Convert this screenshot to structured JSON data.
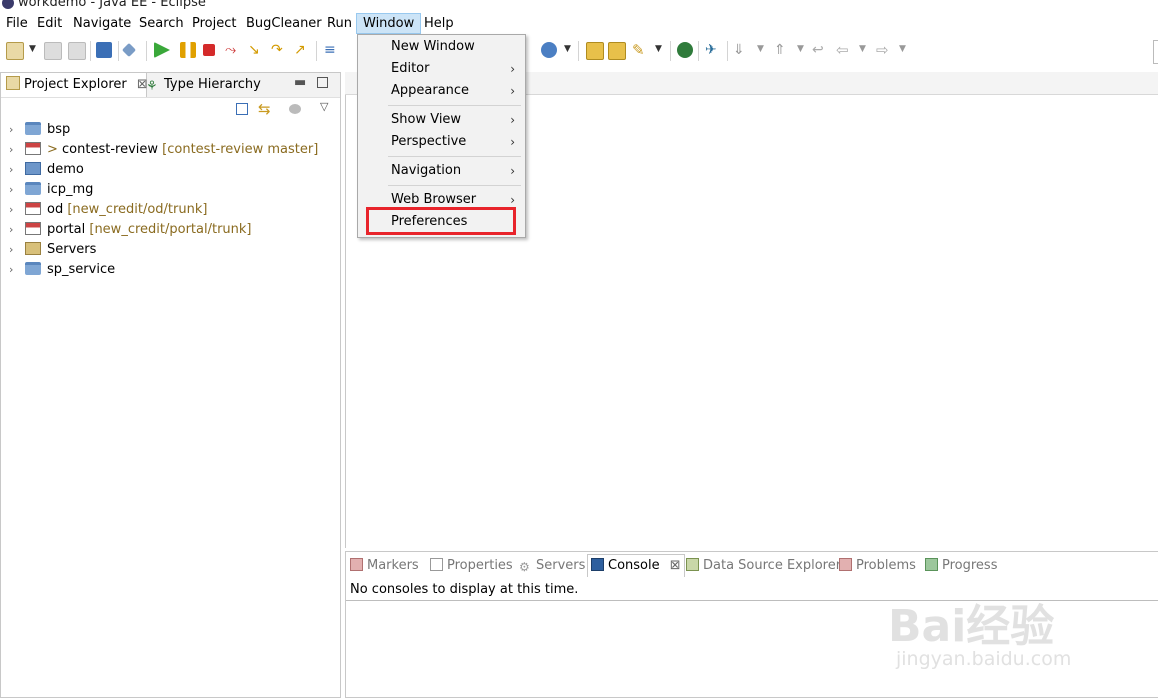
{
  "window": {
    "title": "workdemo - Java EE - Eclipse"
  },
  "menubar": {
    "items": [
      "File",
      "Edit",
      "Navigate",
      "Search",
      "Project",
      "BugCleaner",
      "Run",
      "Window",
      "Help"
    ],
    "active": "Window"
  },
  "left_panel": {
    "tabs": [
      {
        "label": "Project Explorer",
        "close": "⊠",
        "icon": "project-explorer-icon"
      },
      {
        "label": "Type Hierarchy",
        "icon": "type-hierarchy-icon"
      }
    ],
    "tree": [
      {
        "name": "bsp",
        "prefix": "",
        "decoration": "",
        "icon": "folder-icon"
      },
      {
        "name": "contest-review",
        "prefix": "> ",
        "decoration": "[contest-review master]",
        "icon": "project-error-icon"
      },
      {
        "name": "demo",
        "prefix": "",
        "decoration": "",
        "icon": "project-icon"
      },
      {
        "name": "icp_mg",
        "prefix": "",
        "decoration": "",
        "icon": "folder-icon"
      },
      {
        "name": "od",
        "prefix": "",
        "decoration": "[new_credit/od/trunk]",
        "icon": "project-error-icon"
      },
      {
        "name": "portal",
        "prefix": "",
        "decoration": "[new_credit/portal/trunk]",
        "icon": "project-error-icon"
      },
      {
        "name": "Servers",
        "prefix": "",
        "decoration": "",
        "icon": "folder-open-icon"
      },
      {
        "name": "sp_service",
        "prefix": "",
        "decoration": "",
        "icon": "folder-icon"
      }
    ]
  },
  "window_menu": {
    "items": [
      {
        "label": "New Window",
        "submenu": false
      },
      {
        "label": "Editor",
        "submenu": true
      },
      {
        "label": "Appearance",
        "submenu": true
      },
      {
        "label": "Show View",
        "submenu": true
      },
      {
        "label": "Perspective",
        "submenu": true
      },
      {
        "label": "Navigation",
        "submenu": true
      },
      {
        "label": "Web Browser",
        "submenu": true
      },
      {
        "label": "Preferences",
        "submenu": false
      }
    ],
    "submenu_glyph": "›",
    "highlight_color": "#e8242b"
  },
  "bottom_panel": {
    "tabs": [
      {
        "label": "Markers"
      },
      {
        "label": "Properties"
      },
      {
        "label": "Servers"
      },
      {
        "label": "Console",
        "close": "⊠"
      },
      {
        "label": "Data Source Explorer"
      },
      {
        "label": "Problems"
      },
      {
        "label": "Progress"
      }
    ],
    "console_message": "No consoles to display at this time."
  },
  "watermark": {
    "text": "Bai经验",
    "sub": "jingyan.baidu.com"
  },
  "colors": {
    "menu_active_bg": "#cce4f7",
    "decoration": "#8a6b20",
    "folder": "#7fa6d4"
  }
}
